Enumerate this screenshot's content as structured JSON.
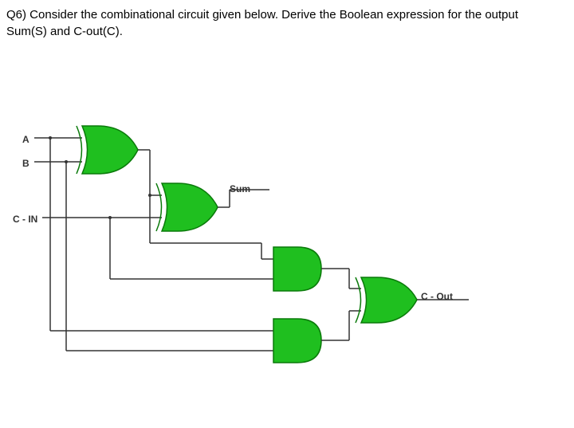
{
  "question": {
    "line1": "Q6) Consider the combinational circuit given below. Derive the Boolean expression for the output",
    "line2": "Sum(S) and C-out(C)."
  },
  "labels": {
    "input_a": "A",
    "input_b": "B",
    "input_cin": "C - IN",
    "output_sum": "Sum",
    "output_cout": "C - Out"
  },
  "chart_data": {
    "type": "circuit_diagram",
    "description": "Full adder combinational logic circuit",
    "inputs": [
      "A",
      "B",
      "C-IN"
    ],
    "outputs": [
      "Sum",
      "C-Out"
    ],
    "gates": [
      {
        "id": "G1",
        "type": "XOR-like",
        "inputs": [
          "A",
          "B"
        ],
        "position": "top-left"
      },
      {
        "id": "G2",
        "type": "XOR-like",
        "inputs": [
          "G1",
          "C-IN"
        ],
        "output": "Sum",
        "position": "middle"
      },
      {
        "id": "G3",
        "type": "AND",
        "inputs": [
          "G1",
          "C-IN"
        ],
        "position": "middle-right"
      },
      {
        "id": "G4",
        "type": "AND",
        "inputs": [
          "A",
          "B"
        ],
        "position": "bottom-right"
      },
      {
        "id": "G5",
        "type": "OR-like",
        "inputs": [
          "G3",
          "G4"
        ],
        "output": "C-Out",
        "position": "right"
      }
    ],
    "colors": {
      "gate_fill": "#1fbf1f",
      "wire": "#333333"
    }
  }
}
